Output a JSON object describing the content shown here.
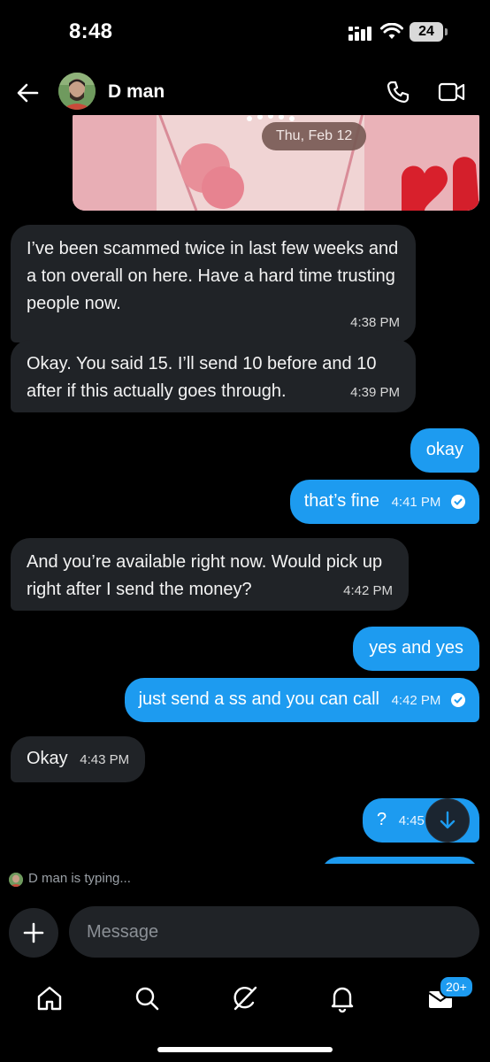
{
  "status_bar": {
    "time": "8:48",
    "battery": "24"
  },
  "header": {
    "contact_name": "D man"
  },
  "chat": {
    "date_divider": "Thu, Feb 12",
    "messages": [
      {
        "direction": "in",
        "text": "I’ve been scammed twice in last few weeks and a ton overall on here. Have a hard time trusting people now.",
        "time": "4:38 PM"
      },
      {
        "direction": "in",
        "text": "Okay. You said 15. I’ll send 10 before and 10 after if this actually goes through.",
        "time": "4:39 PM"
      },
      {
        "direction": "out",
        "text": "okay",
        "time": ""
      },
      {
        "direction": "out",
        "text": "that’s fine",
        "time": "4:41 PM",
        "read": true
      },
      {
        "direction": "in",
        "text": "And you’re available right now. Would pick up right after I send the money?",
        "time": "4:42 PM"
      },
      {
        "direction": "out",
        "text": "yes and yes",
        "time": ""
      },
      {
        "direction": "out",
        "text": "just send a ss and you can call",
        "time": "4:42 PM",
        "read": true
      },
      {
        "direction": "in",
        "text": "Okay",
        "time": "4:43 PM"
      },
      {
        "direction": "out",
        "text": "?",
        "time": "4:45 PM"
      }
    ]
  },
  "typing_indicator": "D man is typing...",
  "composer": {
    "placeholder": "Message"
  },
  "bottom_nav": {
    "items": [
      "home-icon",
      "search-icon",
      "grok-icon",
      "bell-icon",
      "mail-icon"
    ],
    "messages_badge": "20+"
  },
  "colors": {
    "accent": "#1d9bf0",
    "incoming_bubble": "#202327",
    "background": "#000000"
  }
}
